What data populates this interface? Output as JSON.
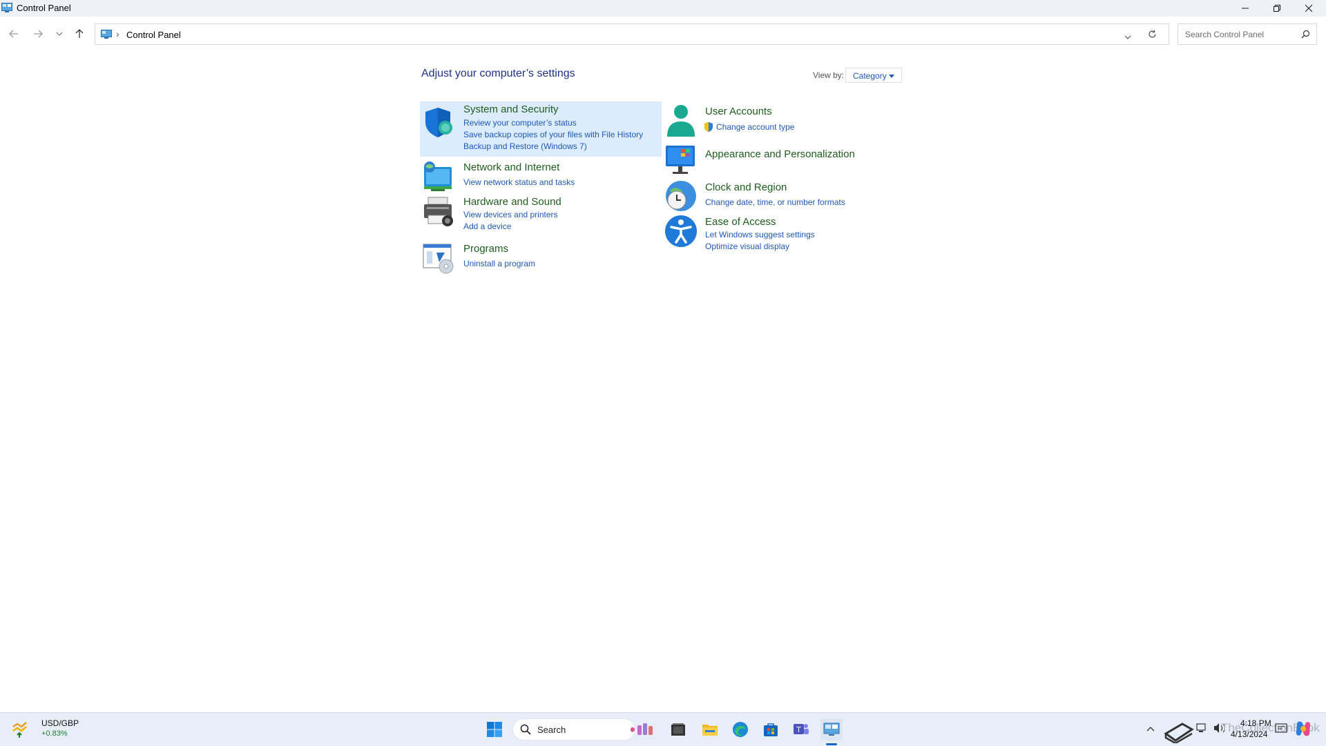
{
  "window": {
    "title": "Control Panel"
  },
  "address": {
    "breadcrumb": "Control Panel",
    "separator": "›"
  },
  "search": {
    "placeholder": "Search Control Panel"
  },
  "main": {
    "heading": "Adjust your computer’s settings",
    "view_by_label": "View by:",
    "view_by_value": "Category"
  },
  "categories": [
    {
      "title": "System and Security",
      "icon": "shield-icon",
      "highlighted": true,
      "links": [
        "Review your computer’s status",
        "Save backup copies of your files with File History",
        "Backup and Restore (Windows 7)"
      ]
    },
    {
      "title": "Network and Internet",
      "icon": "network-globe-icon",
      "links": [
        "View network status and tasks"
      ]
    },
    {
      "title": "Hardware and Sound",
      "icon": "printer-icon",
      "links": [
        "View devices and printers",
        "Add a device"
      ]
    },
    {
      "title": "Programs",
      "icon": "programs-disc-icon",
      "links": [
        "Uninstall a program"
      ]
    },
    {
      "title": "User Accounts",
      "icon": "user-icon",
      "links": [
        "Change account type"
      ]
    },
    {
      "title": "Appearance and Personalization",
      "icon": "monitor-icon",
      "links": []
    },
    {
      "title": "Clock and Region",
      "icon": "clock-globe-icon",
      "links": [
        "Change date, time, or number formats"
      ]
    },
    {
      "title": "Ease of Access",
      "icon": "accessibility-icon",
      "links": [
        "Let Windows suggest settings",
        "Optimize visual display"
      ]
    }
  ],
  "taskbar": {
    "widget_name": "USD/GBP",
    "widget_value": "+0.83%",
    "search_label": "Search",
    "time": "4:18 PM",
    "date": "4/13/2024",
    "watermark": "TheCollectionBook"
  },
  "colors": {
    "heading": "#1e3287",
    "category_title": "#1e5d1e",
    "link": "#1e58b8",
    "highlight": "#dcecfc",
    "taskbar": "#e7eef8"
  }
}
